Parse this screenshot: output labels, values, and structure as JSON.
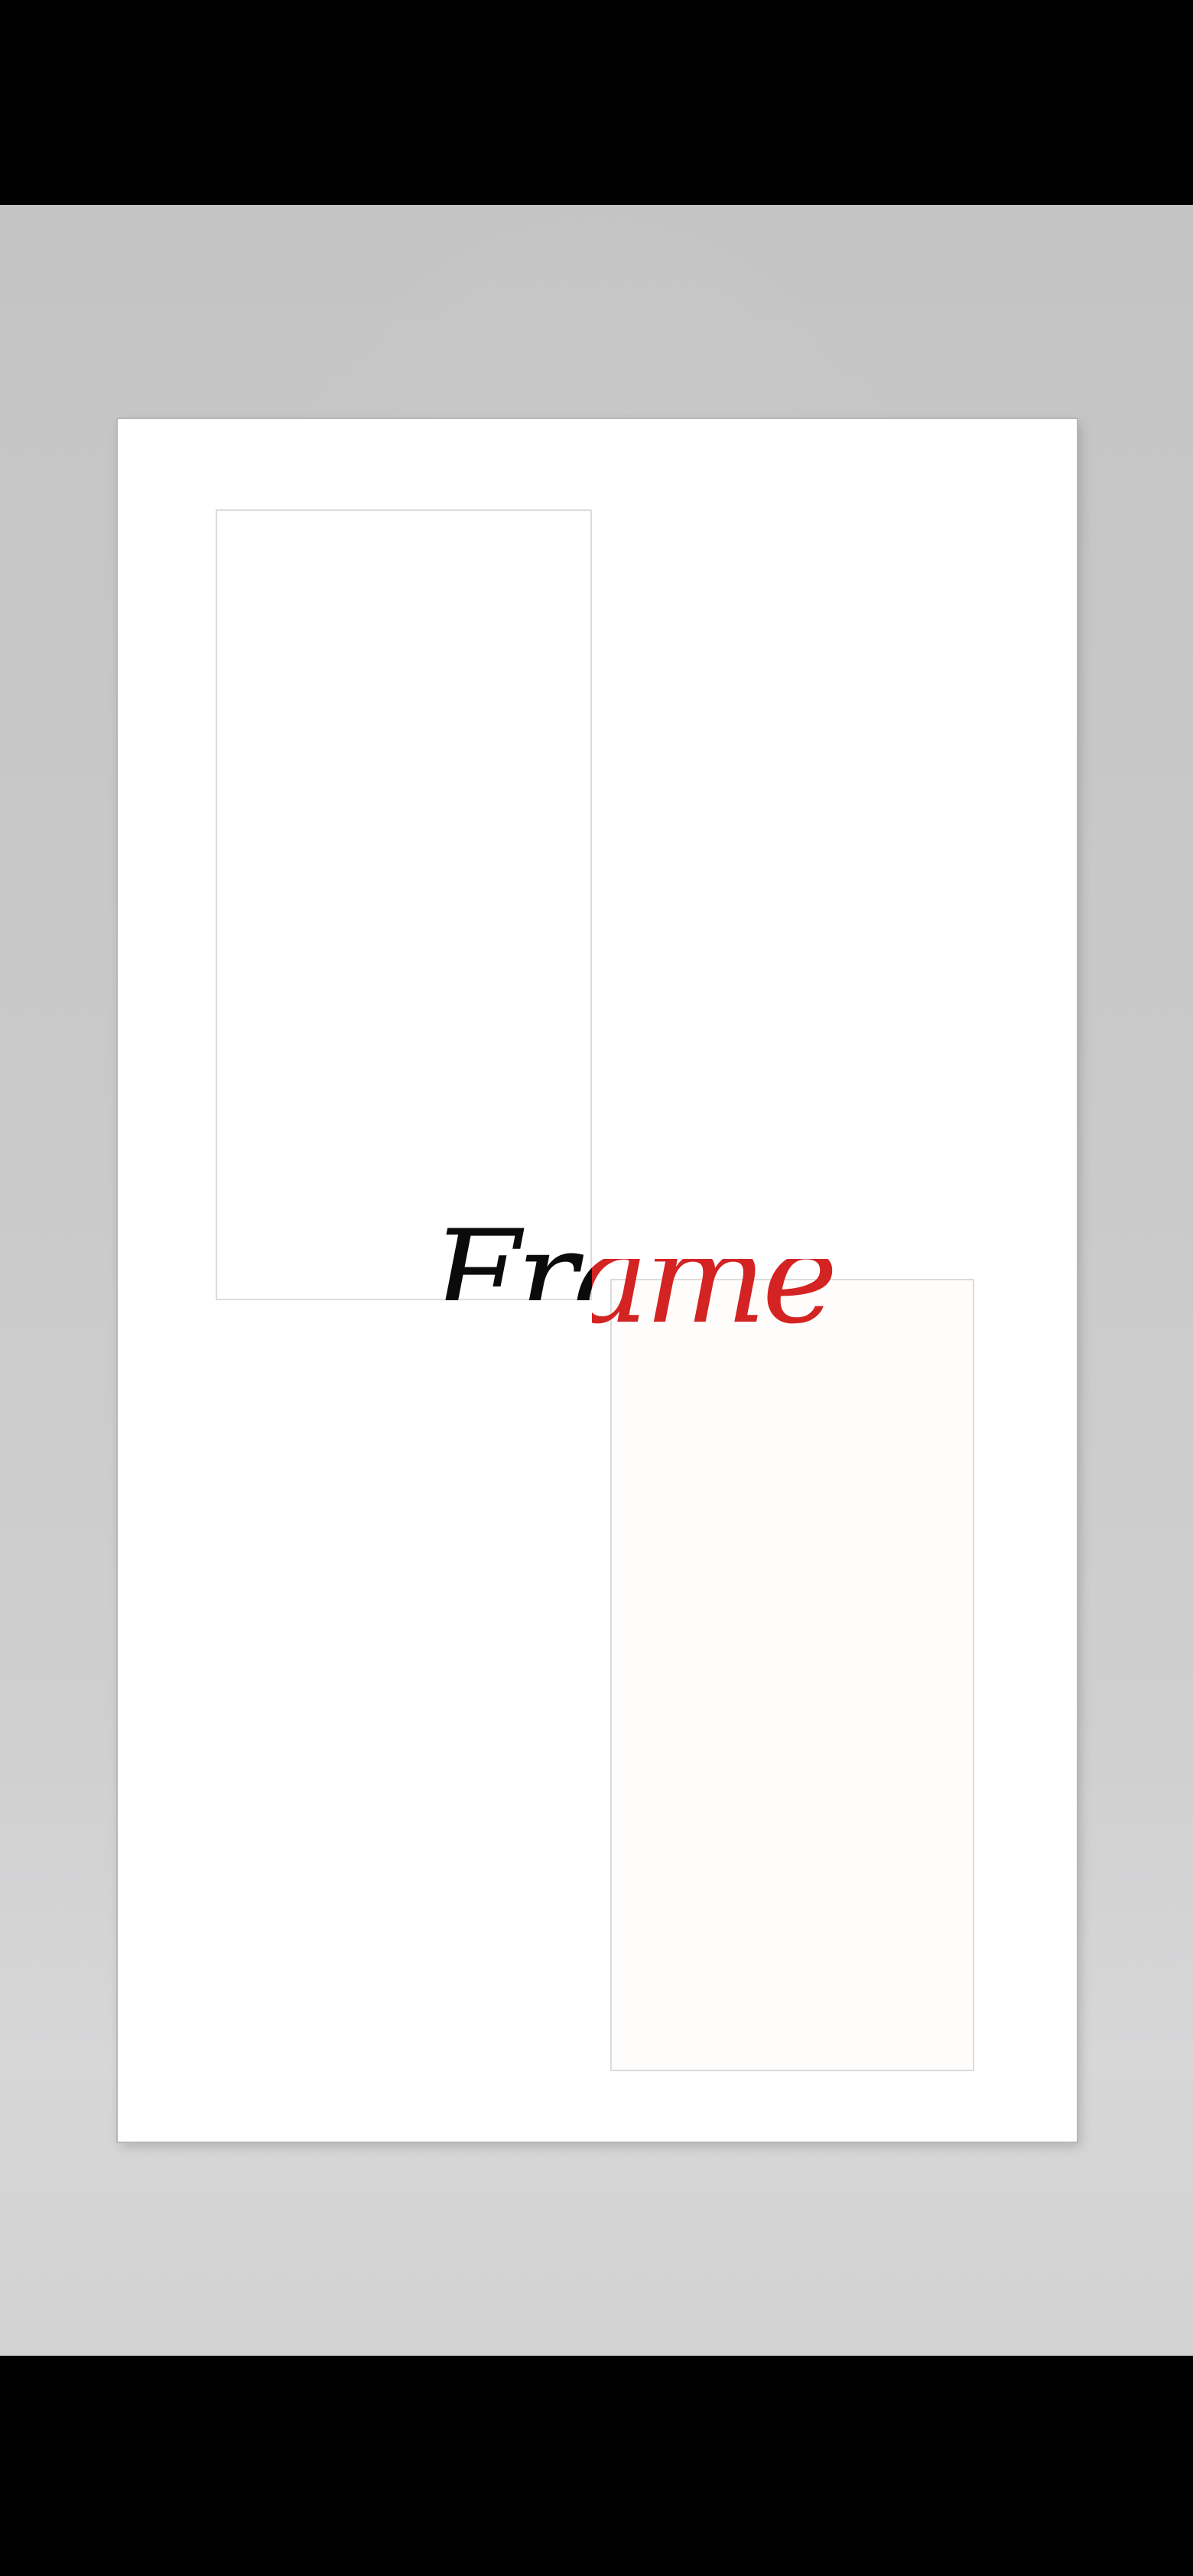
{
  "title": {
    "text": "Frame"
  },
  "colors": {
    "title_primary": "#0b0b0b",
    "title_accent": "#d42323",
    "poster_background": "#ffffff",
    "wall": "#c8c8c8"
  }
}
